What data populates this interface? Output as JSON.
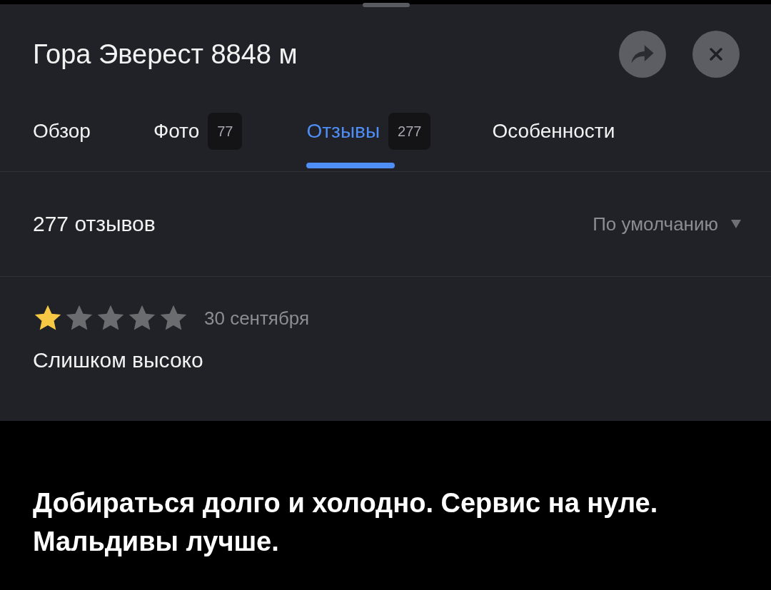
{
  "header": {
    "title": "Гора Эверест 8848 м"
  },
  "tabs": [
    {
      "label": "Обзор",
      "selected": false
    },
    {
      "label": "Фото",
      "count": "77",
      "selected": false
    },
    {
      "label": "Отзывы",
      "count": "277",
      "selected": true
    },
    {
      "label": "Особенности",
      "selected": false
    }
  ],
  "reviews_summary": {
    "count": "277 отзывов",
    "sort": "По умолчанию"
  },
  "reviews": [
    {
      "stars": 1,
      "date": "30 сентября",
      "text": "Слишком высоко"
    }
  ],
  "caption": "Добираться долго и холодно. Сервис на нуле. Мальдивы лучше."
}
